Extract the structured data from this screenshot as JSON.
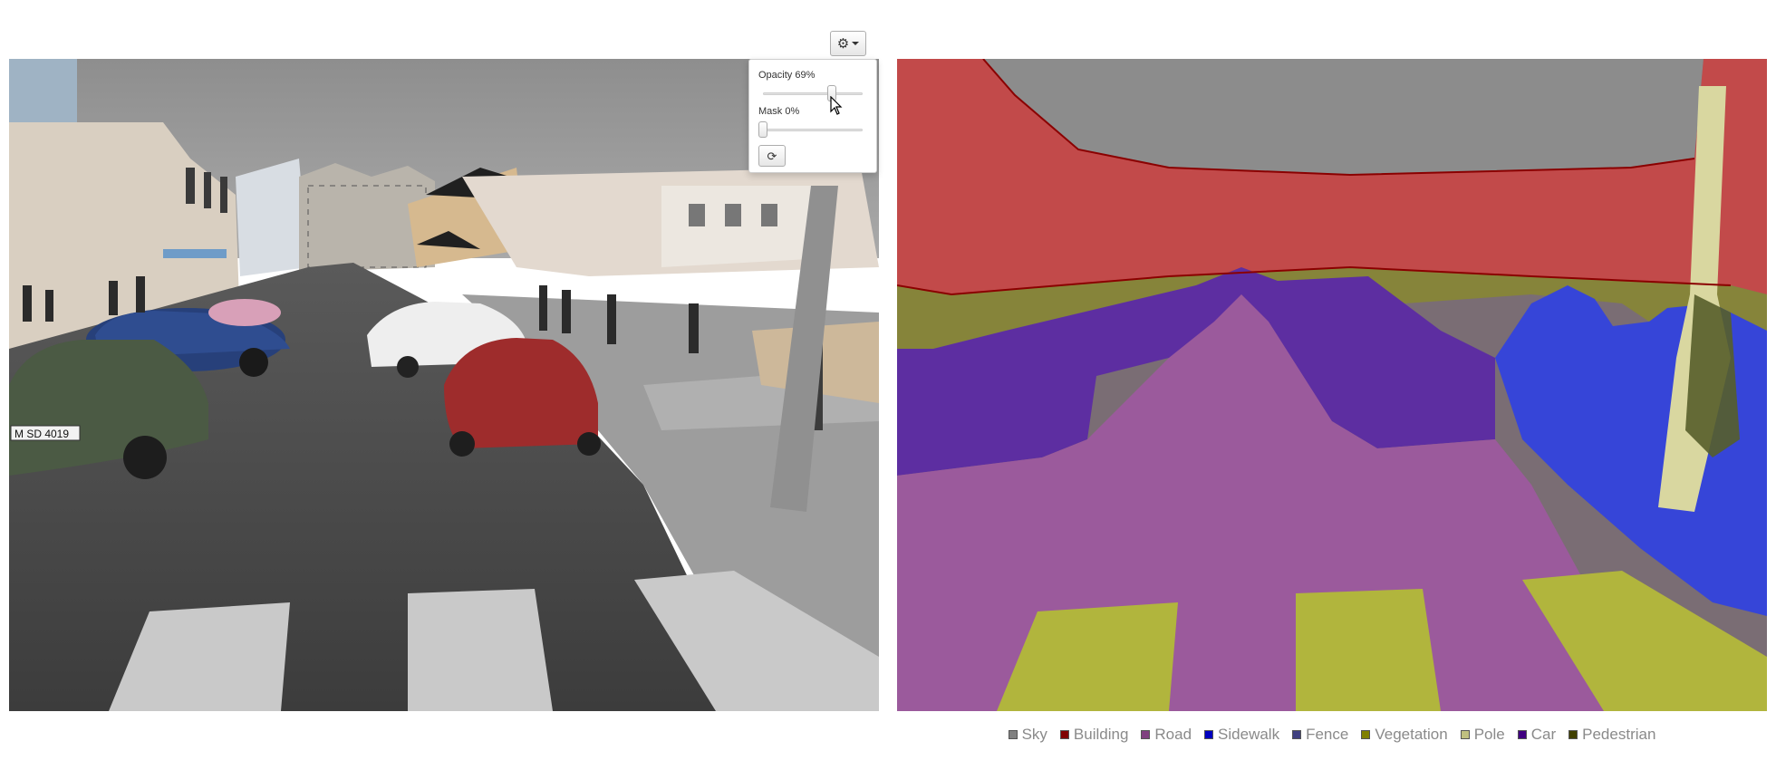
{
  "toolbar": {
    "settings_icon": "gear-icon",
    "dropdown_icon": "caret-down-icon"
  },
  "controls": {
    "opacity_label": "Opacity 69%",
    "opacity_value": 69,
    "mask_label": "Mask 0%",
    "mask_value": 0,
    "refresh_icon": "refresh-icon"
  },
  "scene": {
    "license_plate": "M SD 4019"
  },
  "legend": {
    "items": [
      {
        "label": "Sky",
        "color": "#808080"
      },
      {
        "label": "Building",
        "color": "#800000"
      },
      {
        "label": "Road",
        "color": "#804080"
      },
      {
        "label": "Sidewalk",
        "color": "#0000c0"
      },
      {
        "label": "Fence",
        "color": "#404080"
      },
      {
        "label": "Vegetation",
        "color": "#808000"
      },
      {
        "label": "Pole",
        "color": "#c0c080"
      },
      {
        "label": "Car",
        "color": "#400080"
      },
      {
        "label": "Pedestrian",
        "color": "#404000"
      }
    ]
  }
}
